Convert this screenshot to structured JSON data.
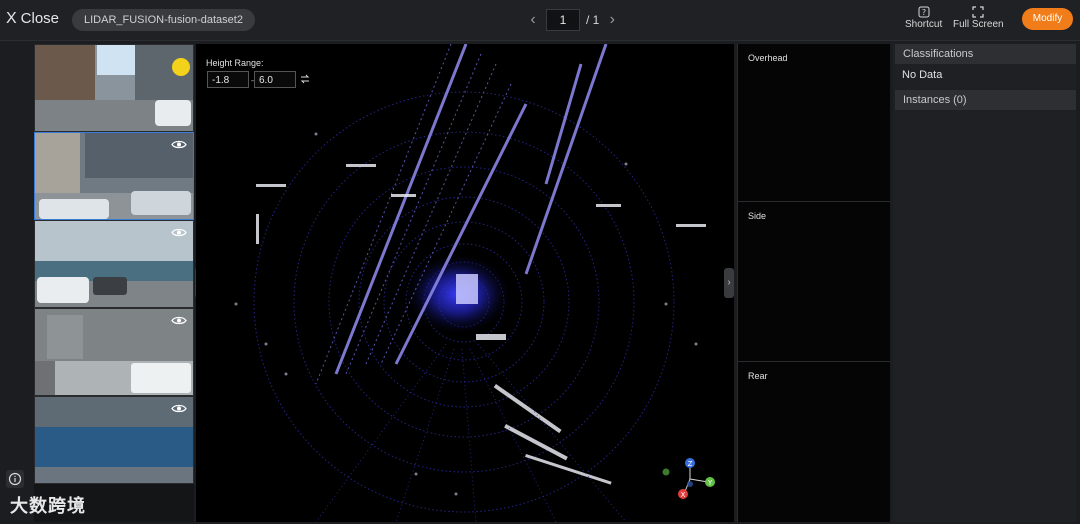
{
  "topbar": {
    "close_label": "Close",
    "close_glyph": "X",
    "dataset_name": "LIDAR_FUSION-fusion-dataset2",
    "page_current": "1",
    "page_total": "/ 1",
    "shortcut_label": "Shortcut",
    "fullscreen_label": "Full Screen",
    "modify_label": "Modify",
    "accent_color": "#f07d1a"
  },
  "viewer": {
    "height_range_label": "Height Range:",
    "height_min": "-1.8",
    "height_max": "6.0",
    "range_separator": "–",
    "axes": [
      "Z",
      "Y",
      "X"
    ]
  },
  "side_views": [
    {
      "label": "Overhead"
    },
    {
      "label": "Side"
    },
    {
      "label": "Rear"
    }
  ],
  "right_panel": {
    "classifications_header": "Classifications",
    "classifications_value": "No Data",
    "instances_header": "Instances (0)"
  },
  "watermark": "大数跨境",
  "icons": {
    "collapse_left": "chevron-left-icon",
    "collapse_right": "chevron-right-icon",
    "visibility": "eye-icon",
    "info": "info-icon"
  }
}
